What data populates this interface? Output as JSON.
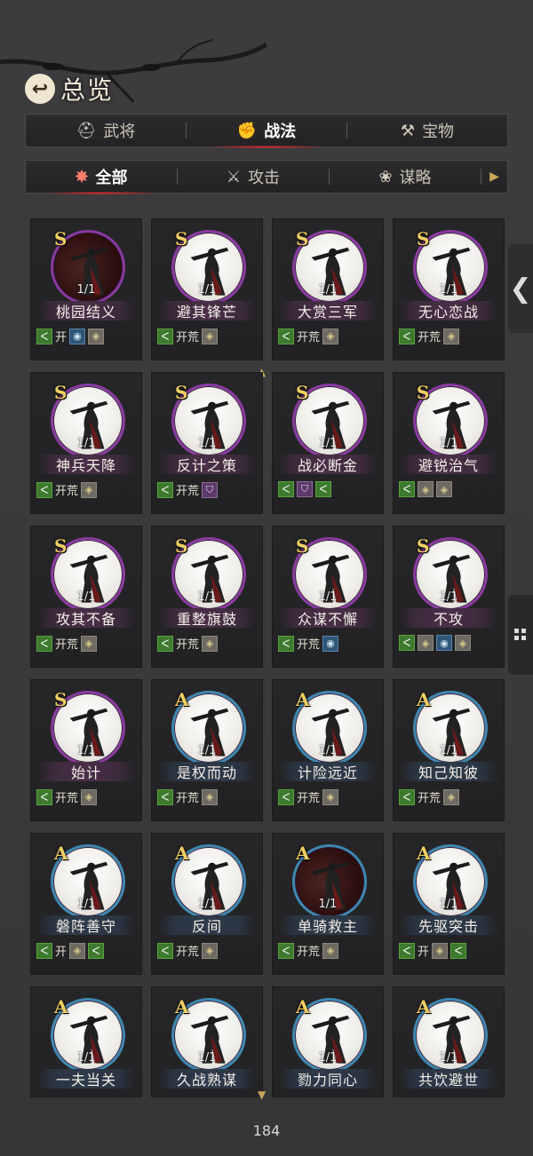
{
  "header": {
    "title": "总览"
  },
  "main_tabs": [
    {
      "label": "武将",
      "icon": "helmet-icon"
    },
    {
      "label": "战法",
      "icon": "fist-icon"
    },
    {
      "label": "宝物",
      "icon": "treasure-icon"
    }
  ],
  "sub_tabs": [
    {
      "label": "全部",
      "icon": "scroll-icon"
    },
    {
      "label": "攻击",
      "icon": "crossed-swords-icon"
    },
    {
      "label": "谋略",
      "icon": "fan-icon"
    }
  ],
  "cards": [
    {
      "rank": "S",
      "level": "1/1",
      "name": "桃园结义",
      "open": "开",
      "tags": [
        "green",
        "blue",
        "gold"
      ],
      "portrait": "dark purple"
    },
    {
      "rank": "S",
      "level": "1/1",
      "name": "避其锋芒",
      "open": "开荒",
      "tags": [
        "green",
        "gold"
      ],
      "portrait": ""
    },
    {
      "rank": "S",
      "level": "1/1",
      "name": "大赏三军",
      "open": "开荒",
      "tags": [
        "green",
        "gold"
      ],
      "portrait": ""
    },
    {
      "rank": "S",
      "level": "1/1",
      "name": "无心恋战",
      "open": "开荒",
      "tags": [
        "green",
        "gold"
      ],
      "portrait": ""
    },
    {
      "rank": "S",
      "level": "1/1",
      "name": "神兵天降",
      "open": "开荒",
      "tags": [
        "green",
        "gold"
      ],
      "portrait": ""
    },
    {
      "rank": "S",
      "level": "1/1",
      "name": "反计之策",
      "open": "开荒",
      "tags": [
        "green",
        "purple"
      ],
      "portrait": ""
    },
    {
      "rank": "S",
      "level": "1/1",
      "name": "战必断金",
      "open": "",
      "tags": [
        "green",
        "purple",
        "green"
      ],
      "portrait": ""
    },
    {
      "rank": "S",
      "level": "1/1",
      "name": "避锐治气",
      "open": "",
      "tags": [
        "green",
        "gold",
        "gold"
      ],
      "portrait": ""
    },
    {
      "rank": "S",
      "level": "1/1",
      "name": "攻其不备",
      "open": "开荒",
      "tags": [
        "green",
        "gold"
      ],
      "portrait": ""
    },
    {
      "rank": "S",
      "level": "1/1",
      "name": "重整旗鼓",
      "open": "开荒",
      "tags": [
        "green",
        "gold"
      ],
      "portrait": ""
    },
    {
      "rank": "S",
      "level": "1/1",
      "name": "众谋不懈",
      "open": "开荒",
      "tags": [
        "green",
        "blue"
      ],
      "portrait": ""
    },
    {
      "rank": "S",
      "level": "1/1",
      "name": "不攻",
      "open": "",
      "tags": [
        "green",
        "gold",
        "blue",
        "gold"
      ],
      "portrait": ""
    },
    {
      "rank": "S",
      "level": "1/1",
      "name": "始计",
      "open": "开荒",
      "tags": [
        "green",
        "gold"
      ],
      "portrait": ""
    },
    {
      "rank": "A",
      "level": "1/1",
      "name": "是权而动",
      "open": "开荒",
      "tags": [
        "green",
        "gold"
      ],
      "portrait": ""
    },
    {
      "rank": "A",
      "level": "1/1",
      "name": "计险远近",
      "open": "开荒",
      "tags": [
        "green",
        "gold"
      ],
      "portrait": ""
    },
    {
      "rank": "A",
      "level": "1/1",
      "name": "知己知彼",
      "open": "开荒",
      "tags": [
        "green",
        "gold"
      ],
      "portrait": ""
    },
    {
      "rank": "A",
      "level": "1/1",
      "name": "磐阵善守",
      "open": "开",
      "tags": [
        "green",
        "gold",
        "green"
      ],
      "portrait": ""
    },
    {
      "rank": "A",
      "level": "1/1",
      "name": "反间",
      "open": "开荒",
      "tags": [
        "green",
        "gold"
      ],
      "portrait": ""
    },
    {
      "rank": "A",
      "level": "1/1",
      "name": "单骑救主",
      "open": "开荒",
      "tags": [
        "green",
        "gold"
      ],
      "portrait": "dark purple"
    },
    {
      "rank": "A",
      "level": "1/1",
      "name": "先驱突击",
      "open": "开",
      "tags": [
        "green",
        "gold",
        "green"
      ],
      "portrait": ""
    },
    {
      "rank": "A",
      "level": "1/1",
      "name": "一夫当关",
      "open": "",
      "tags": [],
      "portrait": ""
    },
    {
      "rank": "A",
      "level": "1/1",
      "name": "久战熟谋",
      "open": "",
      "tags": [],
      "portrait": ""
    },
    {
      "rank": "A",
      "level": "1/1",
      "name": "勠力同心",
      "open": "",
      "tags": [],
      "portrait": ""
    },
    {
      "rank": "A",
      "level": "1/1",
      "name": "共饮避世",
      "open": "",
      "tags": [],
      "portrait": ""
    }
  ],
  "footer": {
    "page_number": "184"
  },
  "colors": {
    "rank_S_border": "#8a3aa0",
    "rank_A_border": "#3e87b0",
    "rank_letter": "#f0cf63",
    "tab_active": "#e33333"
  }
}
